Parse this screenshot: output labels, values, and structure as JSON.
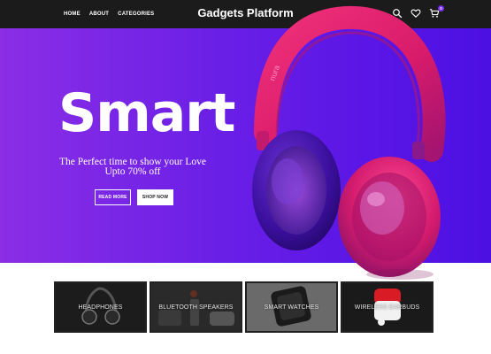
{
  "nav": {
    "links": [
      "HOME",
      "ABOUT",
      "CATEGORIES"
    ],
    "brand": "Gadgets Platform",
    "cart_count": "0",
    "icons": [
      "search-icon",
      "heart-icon",
      "cart-icon"
    ]
  },
  "hero": {
    "title": "Smart",
    "subtitle_line1": "The Perfect time to show your Love",
    "subtitle_line2": "Upto 70% off",
    "read_more": "READ MORE",
    "shop_now": "SHOP NOW",
    "image_brand_text": "nura",
    "colors": {
      "gradient_start": "#8b2ee6",
      "gradient_end": "#4c10e2",
      "headphone": "#e0206a"
    }
  },
  "categories": [
    {
      "label": "HEADPHONES"
    },
    {
      "label": "BLUETOOTH SPEAKERS"
    },
    {
      "label": "SMART WATCHES"
    },
    {
      "label": "WIRELESS EARBUDS"
    }
  ]
}
